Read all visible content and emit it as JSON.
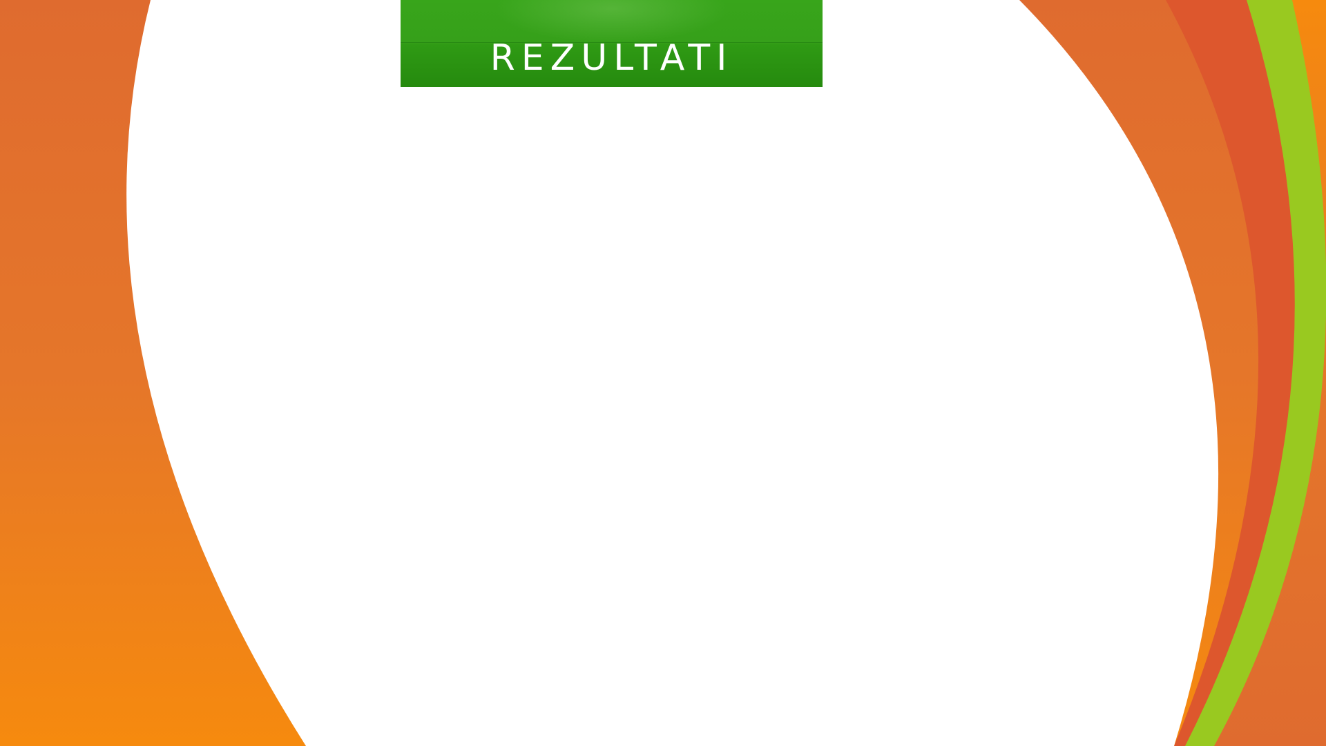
{
  "slide": {
    "title": "REZULTATI"
  },
  "colors": {
    "background_green": "#2e9f12",
    "lime_band": "#99c920",
    "red_orange_band": "#dd572d",
    "orange_band_light": "#f28a12",
    "orange_band_mid": "#df6b2d",
    "content_area": "#ffffff",
    "banner_green": "#36a01a",
    "title_text": "#ffffff"
  }
}
